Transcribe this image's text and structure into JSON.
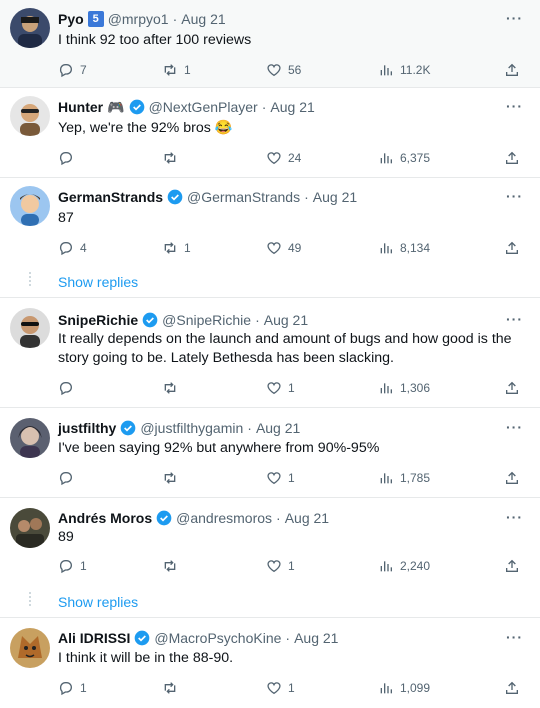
{
  "tweets": [
    {
      "name": "Pyo",
      "badge": "5",
      "handle": "@mrpyo1",
      "date": "Aug 21",
      "text": "I think 92 too after 100 reviews",
      "replies": "7",
      "retweets": "1",
      "likes": "56",
      "views": "11.2K",
      "verified": false
    },
    {
      "name": "Hunter",
      "badge_emoji": "🎮",
      "handle": "@NextGenPlayer",
      "date": "Aug 21",
      "text": "Yep, we're the 92% bros 😂",
      "replies": "",
      "retweets": "",
      "likes": "24",
      "views": "6,375",
      "verified": true
    },
    {
      "name": "GermanStrands",
      "handle": "@GermanStrands",
      "date": "Aug 21",
      "text": "87",
      "replies": "4",
      "retweets": "1",
      "likes": "49",
      "views": "8,134",
      "verified": true
    },
    {
      "name": "SnipeRichie",
      "handle": "@SnipeRichie",
      "date": "Aug 21",
      "text": "It really depends on the launch and amount of bugs and how good is the story going to be. Lately Bethesda has been slacking.",
      "replies": "",
      "retweets": "",
      "likes": "1",
      "views": "1,306",
      "verified": true
    },
    {
      "name": "justfilthy",
      "handle": "@justfilthygamin",
      "date": "Aug 21",
      "text": "I've been saying 92% but anywhere from 90%-95%",
      "replies": "",
      "retweets": "",
      "likes": "1",
      "views": "1,785",
      "verified": true
    },
    {
      "name": "Andrés Moros",
      "handle": "@andresmoros",
      "date": "Aug 21",
      "text": "89",
      "replies": "1",
      "retweets": "",
      "likes": "1",
      "views": "2,240",
      "verified": true
    },
    {
      "name": "Ali IDRISSI",
      "handle": "@MacroPsychoKine",
      "date": "Aug 21",
      "text": "I think it will be in the 88-90.",
      "replies": "1",
      "retweets": "",
      "likes": "1",
      "views": "1,099",
      "verified": true
    }
  ],
  "show_replies_label": "Show replies",
  "separator_dot": "·",
  "colors": {
    "accent": "#1d9bf0",
    "muted": "#536471",
    "text": "#0f1419",
    "highlight_bg": "#f7f9f9",
    "border": "#e7e9ea"
  }
}
